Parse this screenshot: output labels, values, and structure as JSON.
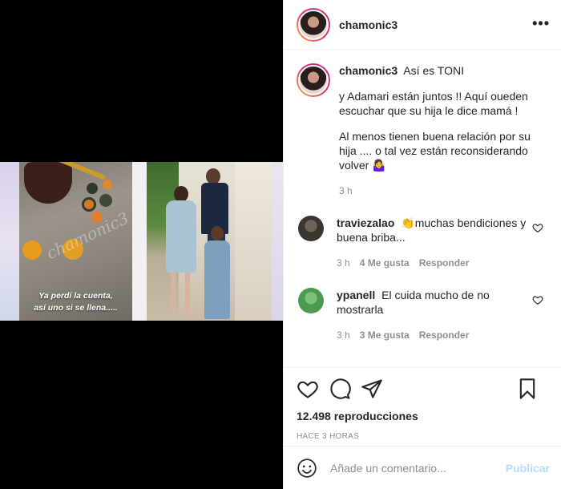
{
  "post": {
    "username": "chamonic3",
    "more_icon": "more-horizontal-icon",
    "media": {
      "overlay_caption_line1": "Ya perdí la cuenta,",
      "overlay_caption_line2": "así uno si se llena.....",
      "watermark": "chamonic3"
    },
    "caption": {
      "username": "chamonic3",
      "lead": "Así es TONI",
      "paragraph1": "y Adamari están juntos !! Aquí oueden escuchar que su hija le dice mamá !",
      "paragraph2": "Al menos tienen buena relación por su hija .... o tal vez están reconsiderando volver 🤷‍♀️",
      "time": "3 h"
    },
    "comments": [
      {
        "username": "traviezalao",
        "text": "👏muchas bendiciones y buena briba...",
        "time": "3 h",
        "likes": "4 Me gusta",
        "reply": "Responder"
      },
      {
        "username": "ypanell",
        "text": "El cuida mucho de no mostrarla",
        "time": "3 h",
        "likes": "3 Me gusta",
        "reply": "Responder"
      }
    ],
    "views": "12.498 reproducciones",
    "posted": "HACE 3 HORAS",
    "add_comment": {
      "placeholder": "Añade un comentario...",
      "publish": "Publicar"
    }
  },
  "colors": {
    "text": "#262626",
    "muted": "#8e8e8e",
    "border": "#efefef",
    "publish_disabled": "#b2dffc"
  }
}
